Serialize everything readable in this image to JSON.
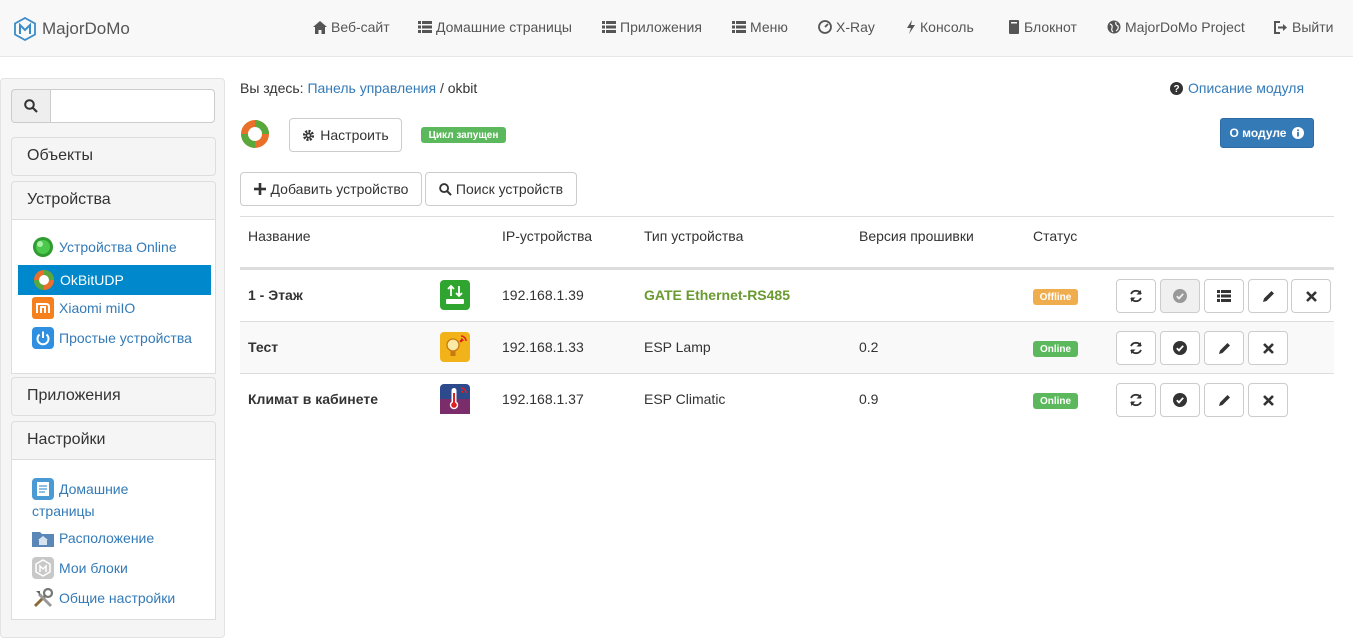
{
  "navbar": {
    "brand": "MajorDoMo",
    "items": [
      {
        "label": "Веб-сайт",
        "icon": "home-icon"
      },
      {
        "label": "Домашние страницы",
        "icon": "th-list-icon"
      },
      {
        "label": "Приложения",
        "icon": "th-list-icon"
      },
      {
        "label": "Меню",
        "icon": "th-list-icon"
      },
      {
        "label": "X-Ray",
        "icon": "dashboard-icon"
      },
      {
        "label": "Консоль",
        "icon": "flash-icon"
      },
      {
        "label": "Блокнот",
        "icon": "book-icon"
      },
      {
        "label": "MajorDoMo Project",
        "icon": "globe-icon"
      },
      {
        "label": "Выйти",
        "icon": "log-out-icon"
      }
    ]
  },
  "sidebar": {
    "search_value": "",
    "sections": [
      {
        "title": "Объекты"
      },
      {
        "title": "Устройства",
        "items": [
          {
            "label": "Устройства Online",
            "icon": "green-ball-icon"
          },
          {
            "label": "OkBitUDP",
            "icon": "okbit-icon",
            "active": true
          },
          {
            "label": "Xiaomi miIO",
            "icon": "xiaomi-icon"
          },
          {
            "label": "Простые устройства",
            "icon": "power-icon"
          }
        ]
      },
      {
        "title": "Приложения"
      },
      {
        "title": "Настройки",
        "items": [
          {
            "label": "Домашние",
            "label2": "страницы",
            "icon": "document-icon"
          },
          {
            "label": "Расположение",
            "icon": "folder-home-icon"
          },
          {
            "label": "Мои блоки",
            "icon": "blocks-icon"
          },
          {
            "label": "Общие настройки",
            "icon": "tools-icon"
          }
        ]
      }
    ]
  },
  "main": {
    "breadcrumb_prefix": "Вы здесь:",
    "breadcrumb_link": "Панель управления",
    "breadcrumb_sep": "/",
    "breadcrumb_current": "okbit",
    "module_help": "Описание модуля",
    "configure_label": "Настроить",
    "cycle_status": "Цикл запущен",
    "about_module": "О модуле",
    "add_device": "Добавить устройство",
    "search_devices": "Поиск устройств"
  },
  "table": {
    "columns": [
      "Название",
      "IP-устройства",
      "Тип устройства",
      "Версия прошивки",
      "Статус"
    ],
    "rows": [
      {
        "name": "1 - Этаж",
        "icon": "gateway-icon",
        "ip": "192.168.1.39",
        "type": "GATE Ethernet-RS485",
        "firmware": "",
        "status": "Offline"
      },
      {
        "name": "Тест",
        "icon": "lamp-icon",
        "ip": "192.168.1.33",
        "type": "ESP Lamp",
        "firmware": "0.2",
        "status": "Online"
      },
      {
        "name": "Климат в кабинете",
        "icon": "thermometer-icon",
        "ip": "192.168.1.37",
        "type": "ESP Climatic",
        "firmware": "0.9",
        "status": "Online"
      }
    ]
  },
  "colors": {
    "link": "#337ab7",
    "active_item": "#0088cc",
    "online": "#5cb85c",
    "offline": "#f0ad4e",
    "gate_type_text": "#6a9a30",
    "primary": "#337ab7"
  }
}
